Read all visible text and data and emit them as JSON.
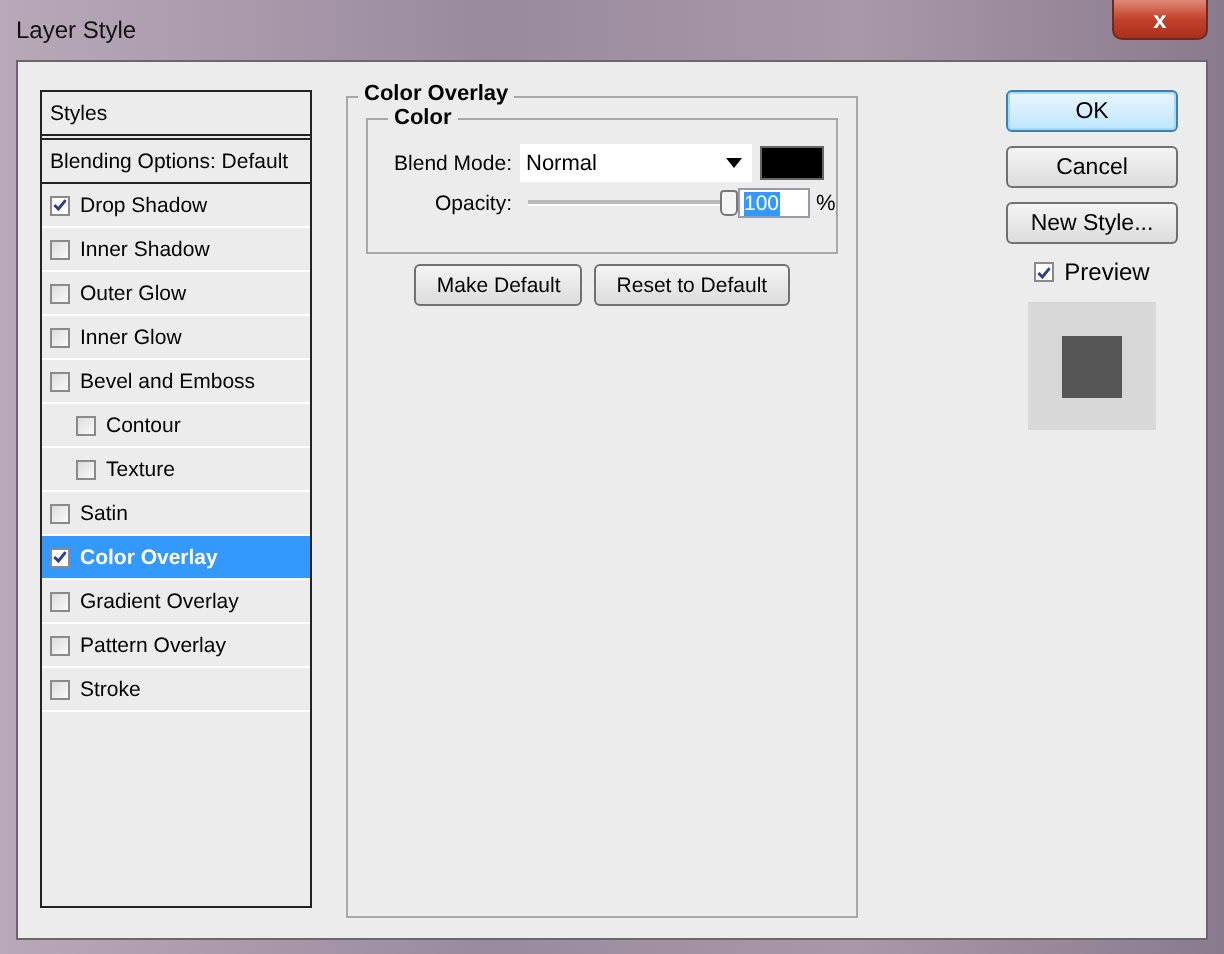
{
  "window": {
    "title": "Layer Style",
    "close": "x"
  },
  "sidebar": {
    "items": [
      {
        "kind": "header",
        "label": "Styles",
        "selected": false
      },
      {
        "kind": "option",
        "label": "Blending Options: Default",
        "selected": false
      },
      {
        "kind": "effect",
        "label": "Drop Shadow",
        "checked": true,
        "selected": false
      },
      {
        "kind": "effect",
        "label": "Inner Shadow",
        "checked": false,
        "selected": false
      },
      {
        "kind": "effect",
        "label": "Outer Glow",
        "checked": false,
        "selected": false
      },
      {
        "kind": "effect",
        "label": "Inner Glow",
        "checked": false,
        "selected": false
      },
      {
        "kind": "effect",
        "label": "Bevel and Emboss",
        "checked": false,
        "selected": false,
        "children": [
          {
            "kind": "effect",
            "label": "Contour",
            "checked": false,
            "selected": false
          },
          {
            "kind": "effect",
            "label": "Texture",
            "checked": false,
            "selected": false
          }
        ]
      },
      {
        "kind": "effect",
        "label": "Satin",
        "checked": false,
        "selected": false
      },
      {
        "kind": "effect",
        "label": "Color Overlay",
        "checked": true,
        "selected": true
      },
      {
        "kind": "effect",
        "label": "Gradient Overlay",
        "checked": false,
        "selected": false
      },
      {
        "kind": "effect",
        "label": "Pattern Overlay",
        "checked": false,
        "selected": false
      },
      {
        "kind": "effect",
        "label": "Stroke",
        "checked": false,
        "selected": false
      }
    ]
  },
  "panel": {
    "title": "Color Overlay",
    "group": "Color",
    "blend_mode": {
      "label": "Blend Mode:",
      "value": "Normal"
    },
    "opacity": {
      "label": "Opacity:",
      "level": 1,
      "value": "100",
      "value_selected": true,
      "unit": "%"
    },
    "buttons": [
      "Make Default",
      "Reset to Default"
    ]
  },
  "actions": [
    {
      "label": "OK",
      "default": true
    },
    {
      "label": "Cancel",
      "default": false
    },
    {
      "label": "New Style...",
      "default": false
    }
  ],
  "preview": {
    "label": "Preview",
    "checked": true
  }
}
